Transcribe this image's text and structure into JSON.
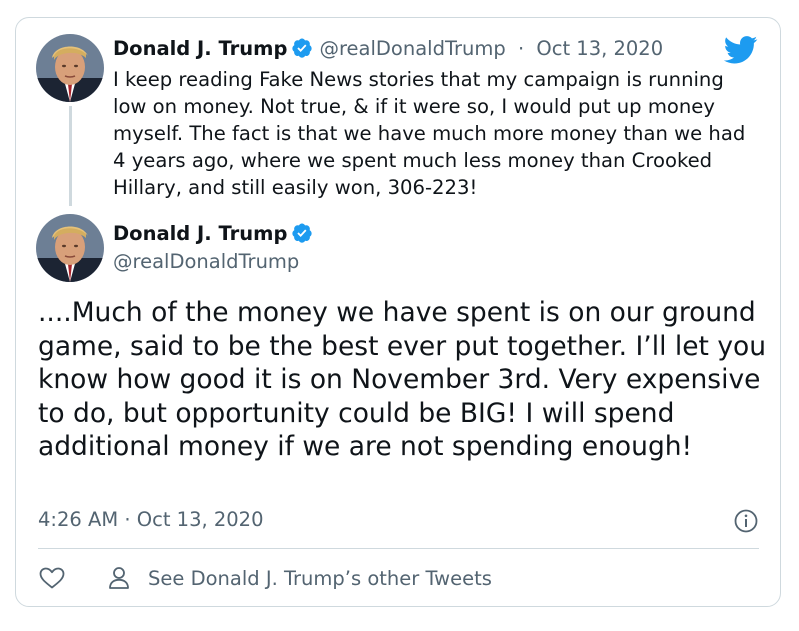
{
  "quoted_tweet": {
    "display_name": "Donald J. Trump",
    "handle": "@realDonaldTrump",
    "separator": "·",
    "date": "Oct 13, 2020",
    "text": "I keep reading Fake News stories that my campaign is running low on money. Not true, & if it were so, I would put up money myself. The fact is that we have much more money than we had 4 years ago, where we spent much less money than Crooked Hillary, and still easily won, 306-223!"
  },
  "main_tweet": {
    "display_name": "Donald J. Trump",
    "handle": "@realDonaldTrump",
    "text": "....Much of the money we have spent is on our ground game, said to be the best ever put together. I’ll let you know how good it is on November 3rd. Very expensive to do, but opportunity could be BIG! I will spend additional money if we are not spending enough!",
    "timestamp": "4:26 AM · Oct 13, 2020"
  },
  "actions": {
    "other_tweets_label": "See Donald J. Trump’s other Tweets"
  },
  "colors": {
    "twitter_blue": "#1d9bf0",
    "secondary_text": "#536471",
    "border": "#cfd9de"
  },
  "icons": [
    "twitter-bird-icon",
    "verified-badge-icon",
    "info-icon",
    "heart-icon",
    "person-icon"
  ]
}
